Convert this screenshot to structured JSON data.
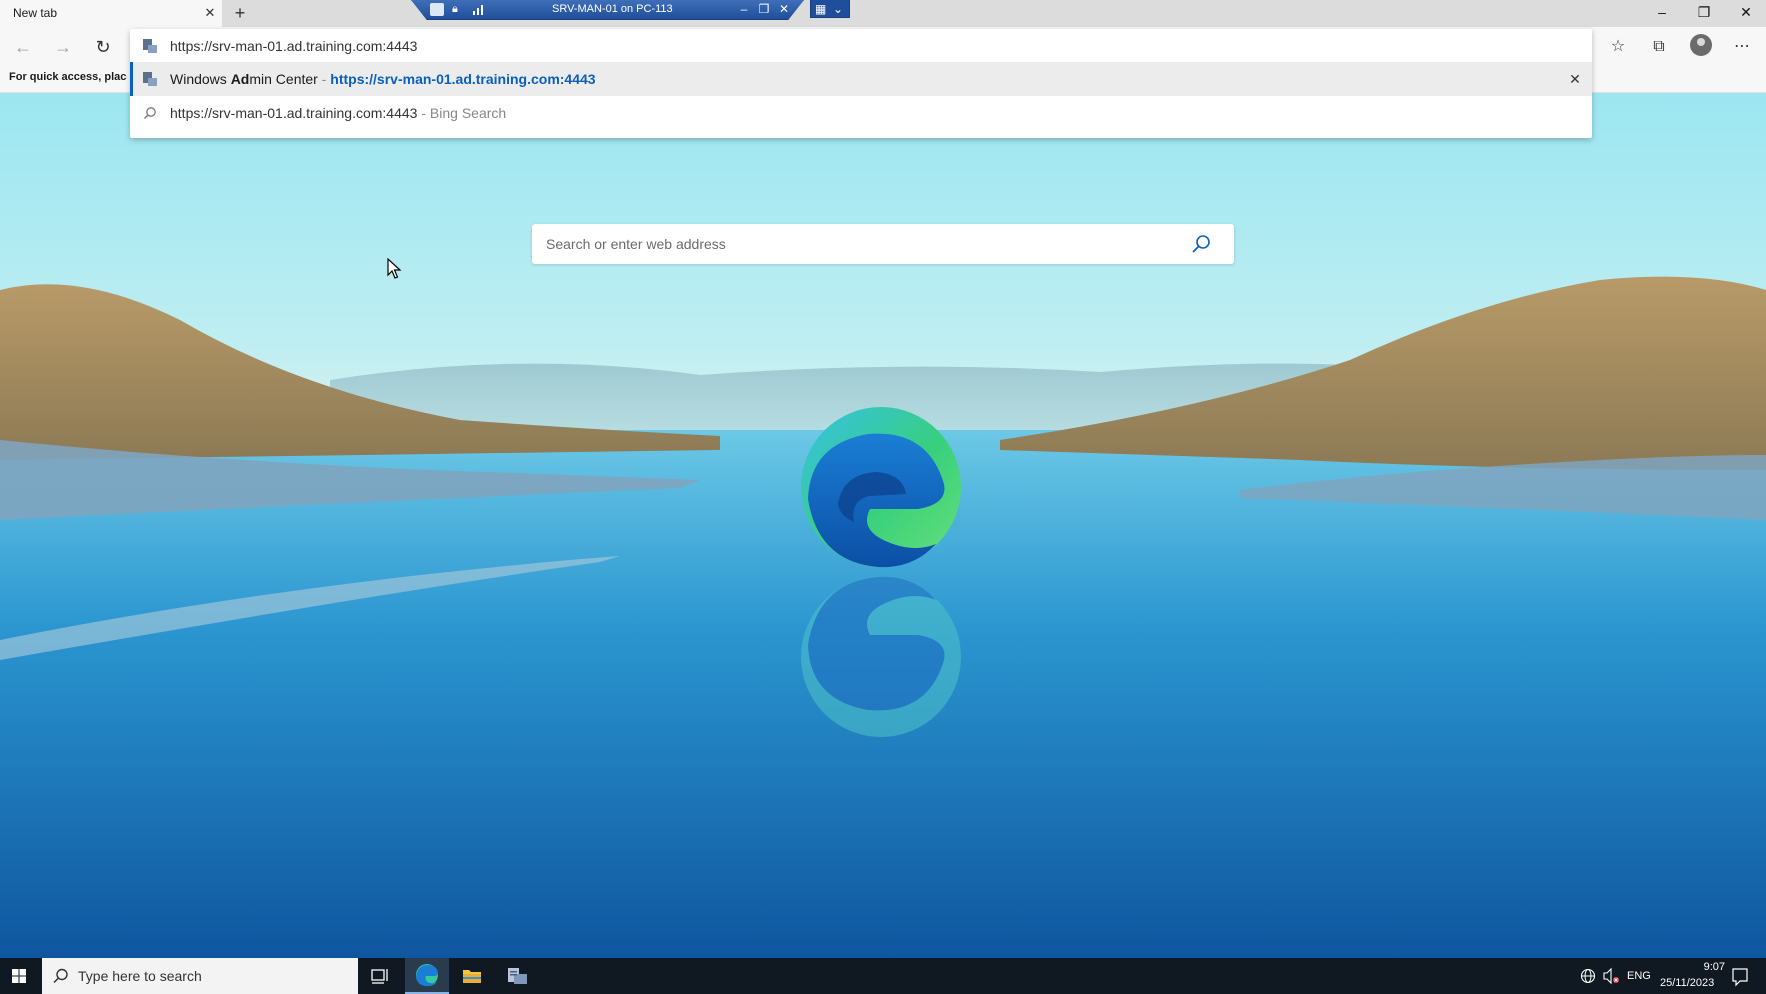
{
  "browser": {
    "tab_title": "New tab",
    "favbar_hint": "For quick access, place y",
    "omnibox": {
      "value": "https://srv-man-01.ad.training.com:4443",
      "suggestion": {
        "title_pre": "Windows ",
        "title_bold": "Ad",
        "title_post": "min Center",
        "separator": " - ",
        "url": "https://srv-man-01.ad.training.com:4443"
      },
      "search_suggestion": {
        "text": "https://srv-man-01.ad.training.com:4443",
        "hint": " - Bing Search"
      }
    }
  },
  "rdp_bar": {
    "title": "SRV-MAN-01 on PC-113"
  },
  "page": {
    "search_placeholder": "Search or enter web address"
  },
  "taskbar": {
    "search_placeholder": "Type here to search",
    "language": "ENG",
    "time": "9:07",
    "date": "25/11/2023"
  },
  "icons": {
    "tab_close": "close-icon",
    "new_tab": "plus-icon",
    "back": "back-arrow-icon",
    "forward": "forward-arrow-icon",
    "refresh": "refresh-icon",
    "favorites": "favorites-icon",
    "collections": "collections-icon",
    "profile": "profile-icon",
    "menu": "more-icon"
  }
}
